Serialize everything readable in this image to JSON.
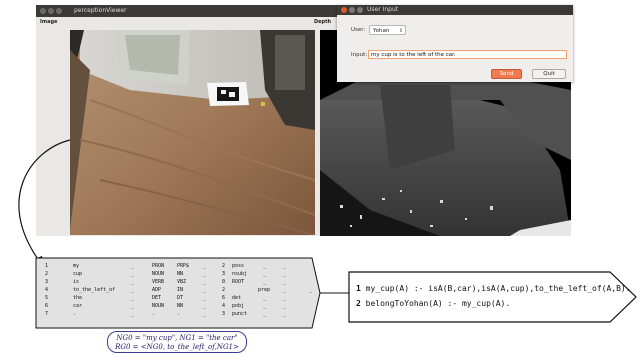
{
  "viewer": {
    "title": "perceptionViewer",
    "image_label": "Image",
    "depth_label": "Depth"
  },
  "dialog": {
    "title": "User Input",
    "user_label": "User:",
    "user_value": "Yohan",
    "input_label": "Input:",
    "input_value": "my cup is to the left of the car.",
    "send_label": "Send",
    "quit_label": "Quit"
  },
  "parse_table": {
    "rows": [
      [
        "1",
        "my",
        "_",
        "PRON",
        "PRP$",
        "_",
        "2",
        "poss",
        "_",
        "_"
      ],
      [
        "2",
        "cup",
        "_",
        "NOUN",
        "NN",
        "_",
        "3",
        "nsubj",
        "_",
        "_"
      ],
      [
        "3",
        "is",
        "_",
        "VERB",
        "VBZ",
        "_",
        "0",
        "ROOT",
        "_",
        "_"
      ],
      [
        "4",
        "to_the_left_of",
        "_",
        "ADP",
        "IN",
        "_",
        "2",
        "prep",
        "_",
        "_"
      ],
      [
        "5",
        "the",
        "_",
        "DET",
        "DT",
        "_",
        "6",
        "det",
        "_",
        "_"
      ],
      [
        "6",
        "car",
        "_",
        "NOUN",
        "NN",
        "_",
        "4",
        "pobj",
        "_",
        "_"
      ],
      [
        "7",
        ".",
        "_",
        ".",
        ".",
        "_",
        "3",
        "punct",
        "_",
        "_"
      ]
    ]
  },
  "ng_note": {
    "line1": "NG0 = \"my cup\", NG1 = \"the car\"",
    "line2": "RG0 = <NG0, to_the_left_of,NG1>"
  },
  "logic": {
    "lines": [
      {
        "num": "1",
        "text": "my_cup(A) :- isA(B,car),isA(A,cup),to_the_left_of(A,B)."
      },
      {
        "num": "2",
        "text": "belongToYohan(A) :- my_cup(A)."
      }
    ]
  }
}
